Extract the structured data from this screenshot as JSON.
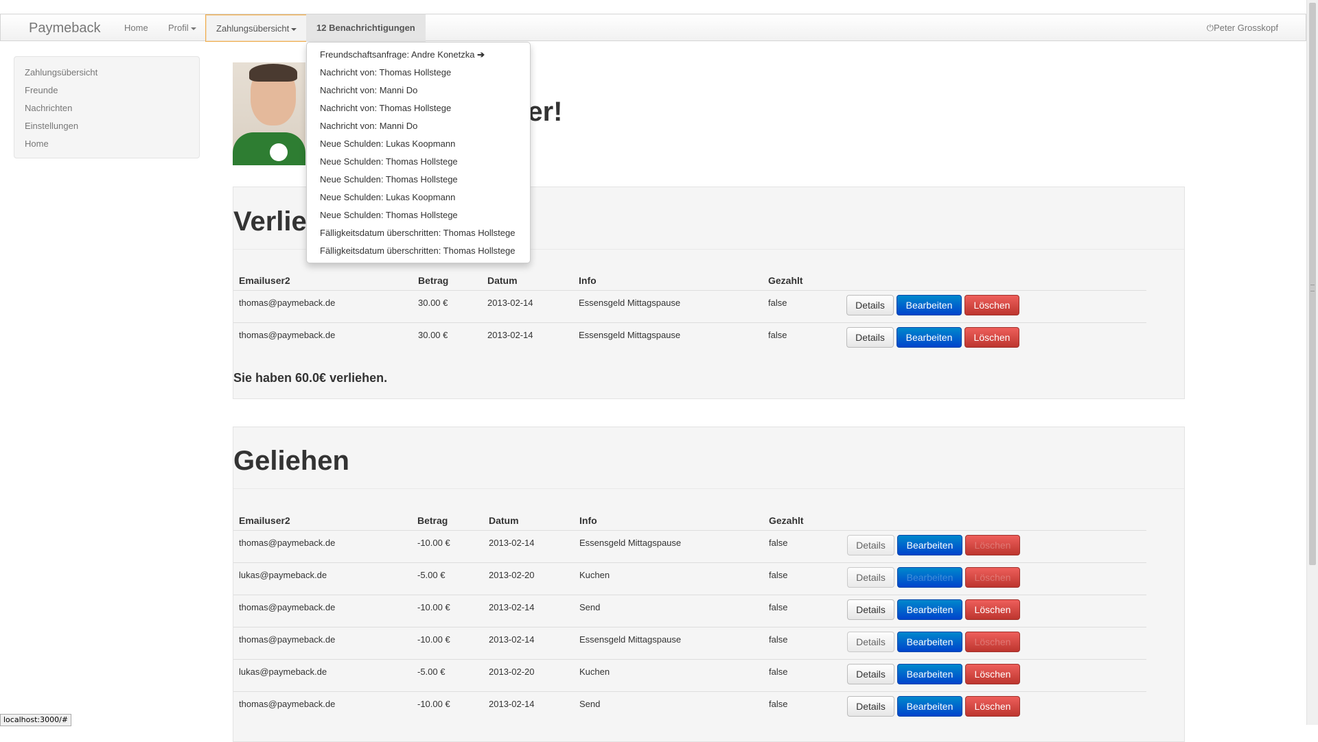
{
  "navbar": {
    "brand": "Paymeback",
    "home": "Home",
    "profil": "Profil",
    "zahlung": "Zahlungsübersicht",
    "notifications": "12 Benachrichtigungen",
    "user": "Peter Grosskopf"
  },
  "sidebar": {
    "items": [
      {
        "label": "Zahlungsübersicht"
      },
      {
        "label": "Freunde"
      },
      {
        "label": "Nachrichten"
      },
      {
        "label": "Einstellungen"
      },
      {
        "label": "Home"
      }
    ]
  },
  "hero": {
    "title": "ter!"
  },
  "dropdown": {
    "items": [
      "Freundschaftsanfrage: Andre Konetzka",
      "Nachricht von: Thomas Hollstege",
      "Nachricht von: Manni Do",
      "Nachricht von: Thomas Hollstege",
      "Nachricht von: Manni Do",
      "Neue Schulden: Lukas Koopmann",
      "Neue Schulden: Thomas Hollstege",
      "Neue Schulden: Thomas Hollstege",
      "Neue Schulden: Lukas Koopmann",
      "Neue Schulden: Thomas Hollstege",
      "Fälligkeitsdatum überschritten: Thomas Hollstege",
      "Fälligkeitsdatum überschritten: Thomas Hollstege"
    ]
  },
  "verliehen": {
    "title": "Verlie",
    "headers": [
      "Emailuser2",
      "Betrag",
      "Datum",
      "Info",
      "Gezahlt"
    ],
    "rows": [
      {
        "email": "thomas@paymeback.de",
        "betrag": "30.00 €",
        "datum": "2013-02-14",
        "info": "Essensgeld Mittagspause",
        "gezahlt": "false"
      },
      {
        "email": "thomas@paymeback.de",
        "betrag": "30.00 €",
        "datum": "2013-02-14",
        "info": "Essensgeld Mittagspause",
        "gezahlt": "false"
      }
    ],
    "summary": "Sie haben 60.0€ verliehen."
  },
  "geliehen": {
    "title": "Geliehen",
    "headers": [
      "Emailuser2",
      "Betrag",
      "Datum",
      "Info",
      "Gezahlt"
    ],
    "rows": [
      {
        "email": "thomas@paymeback.de",
        "betrag": "-10.00 €",
        "datum": "2013-02-14",
        "info": "Essensgeld Mittagspause",
        "gezahlt": "false"
      },
      {
        "email": "lukas@paymeback.de",
        "betrag": "-5.00 €",
        "datum": "2013-02-20",
        "info": "Kuchen",
        "gezahlt": "false"
      },
      {
        "email": "thomas@paymeback.de",
        "betrag": "-10.00 €",
        "datum": "2013-02-14",
        "info": "Send",
        "gezahlt": "false"
      },
      {
        "email": "thomas@paymeback.de",
        "betrag": "-10.00 €",
        "datum": "2013-02-14",
        "info": "Essensgeld Mittagspause",
        "gezahlt": "false"
      },
      {
        "email": "lukas@paymeback.de",
        "betrag": "-5.00 €",
        "datum": "2013-02-20",
        "info": "Kuchen",
        "gezahlt": "false"
      },
      {
        "email": "thomas@paymeback.de",
        "betrag": "-10.00 €",
        "datum": "2013-02-14",
        "info": "Send",
        "gezahlt": "false"
      }
    ]
  },
  "buttons": {
    "details": "Details",
    "bearbeiten": "Bearbeiten",
    "loeschen": "Löschen"
  },
  "status_url": "localhost:3000/#"
}
